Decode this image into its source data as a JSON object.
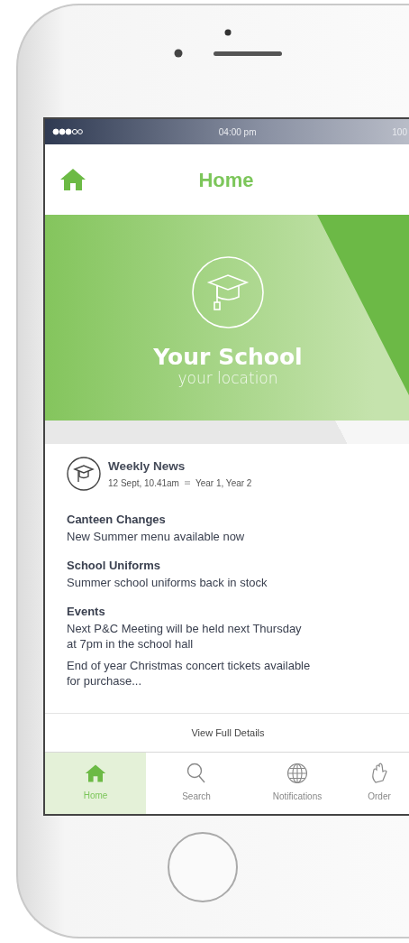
{
  "status_bar": {
    "time": "04:00 pm",
    "battery": "100"
  },
  "header": {
    "title": "Home"
  },
  "hero": {
    "title": "Your School",
    "subtitle": "your location"
  },
  "news": {
    "title": "Weekly News",
    "date": "12 Sept, 10.41am",
    "audience": "Year 1, Year 2",
    "sections": [
      {
        "heading": "Canteen Changes",
        "paragraphs": [
          "New Summer menu available now"
        ]
      },
      {
        "heading": "School Uniforms",
        "paragraphs": [
          "Summer school uniforms back in stock"
        ]
      },
      {
        "heading": "Events",
        "paragraphs": [
          "Next P&C Meeting will be held next Thursday at 7pm in the school hall",
          "End of year Christmas concert tickets available for purchase..."
        ]
      }
    ],
    "link": "View Full Details"
  },
  "tabs": [
    {
      "label": "Home",
      "selected": true
    },
    {
      "label": "Search",
      "selected": false
    },
    {
      "label": "Notifications",
      "selected": false
    },
    {
      "label": "Order",
      "selected": false
    }
  ]
}
